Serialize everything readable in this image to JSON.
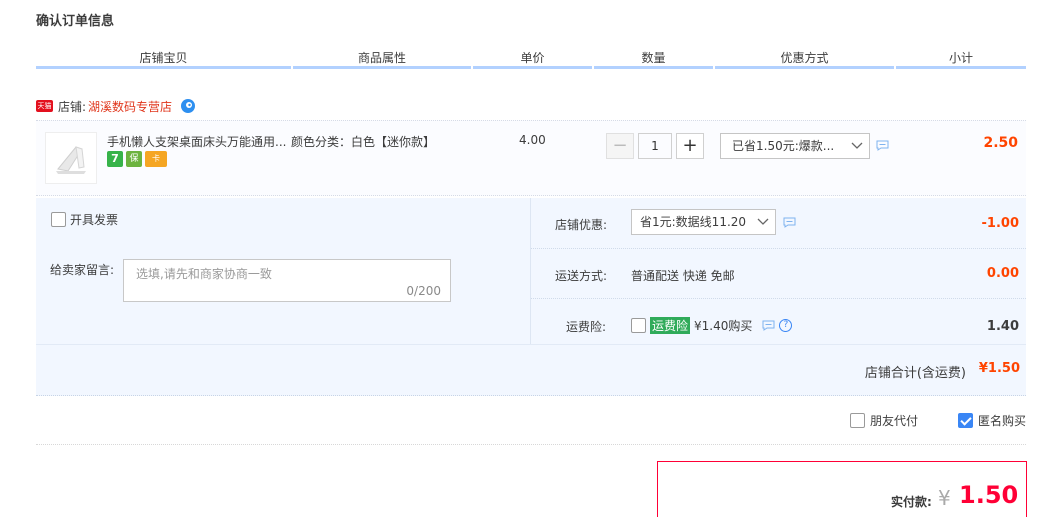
{
  "page": {
    "title": "确认订单信息"
  },
  "columns": [
    "店铺宝贝",
    "商品属性",
    "单价",
    "数量",
    "优惠方式",
    "小计"
  ],
  "shop": {
    "badge": "天猫",
    "label": "店铺:",
    "name": "湖溪数码专营店"
  },
  "item": {
    "title": "手机懒人支架桌面床头万能通用...",
    "attr": "颜色分类：白色【迷你款】",
    "badges": [
      "7",
      "保",
      "卡"
    ],
    "unit_price": "4.00",
    "quantity": "1",
    "minus": "−",
    "plus": "+",
    "promo": "已省1.50元:爆款...",
    "subtotal": "2.50"
  },
  "invoice": {
    "label": "开具发票",
    "checked": false
  },
  "message": {
    "label": "给卖家留言:",
    "placeholder": "选填,请先和商家协商一致",
    "count": "0/200"
  },
  "shop_discount": {
    "label": "店铺优惠:",
    "selected": "省1元:数据线11.20",
    "value": "-1.00"
  },
  "shipping": {
    "label": "运送方式:",
    "method": "普通配送 快递 免邮",
    "value": "0.00"
  },
  "insurance": {
    "label": "运费险:",
    "tag": "运费险",
    "text": "¥1.40购买",
    "help": "?",
    "value": "1.40",
    "checked": false
  },
  "shop_total": {
    "label": "店铺合计(含运费)",
    "value": "¥1.50"
  },
  "options": {
    "friend_pay": "朋友代付",
    "friend_pay_checked": false,
    "anonymous": "匿名购买",
    "anonymous_checked": true
  },
  "payment": {
    "label": "实付款:",
    "currency": "¥",
    "amount": "1.50"
  },
  "colors": {
    "accent_red": "#ff4400",
    "header_line": "#b2d1ff",
    "panel_bg": "#f2f7ff",
    "checkbox_blue": "#3a86f5"
  }
}
